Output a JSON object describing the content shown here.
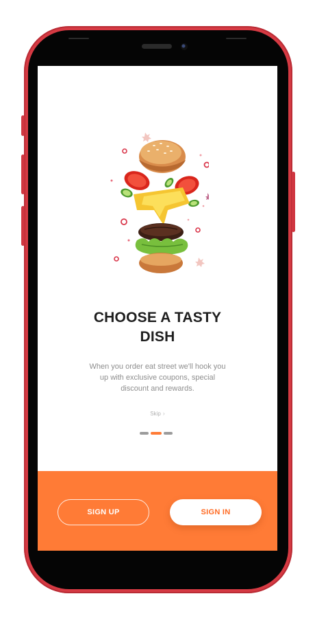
{
  "onboarding": {
    "title_line1": "CHOOSE A TASTY",
    "title_line2": "DISH",
    "description": "When you order eat street we'll hook you up with exclusive coupons, special discount and rewards.",
    "skip_label": "Skip",
    "skip_icon": "chevron-right-icon",
    "page_indicator": {
      "total": 3,
      "active_index": 1
    }
  },
  "actions": {
    "sign_up_label": "SIGN UP",
    "sign_in_label": "SIGN IN"
  },
  "colors": {
    "accent": "#ff7b36",
    "phone_frame": "#d63a43",
    "title_text": "#1e1e1e",
    "body_text": "#8d8d8d"
  },
  "illustration": {
    "icon": "burger-ingredients-illustration"
  }
}
